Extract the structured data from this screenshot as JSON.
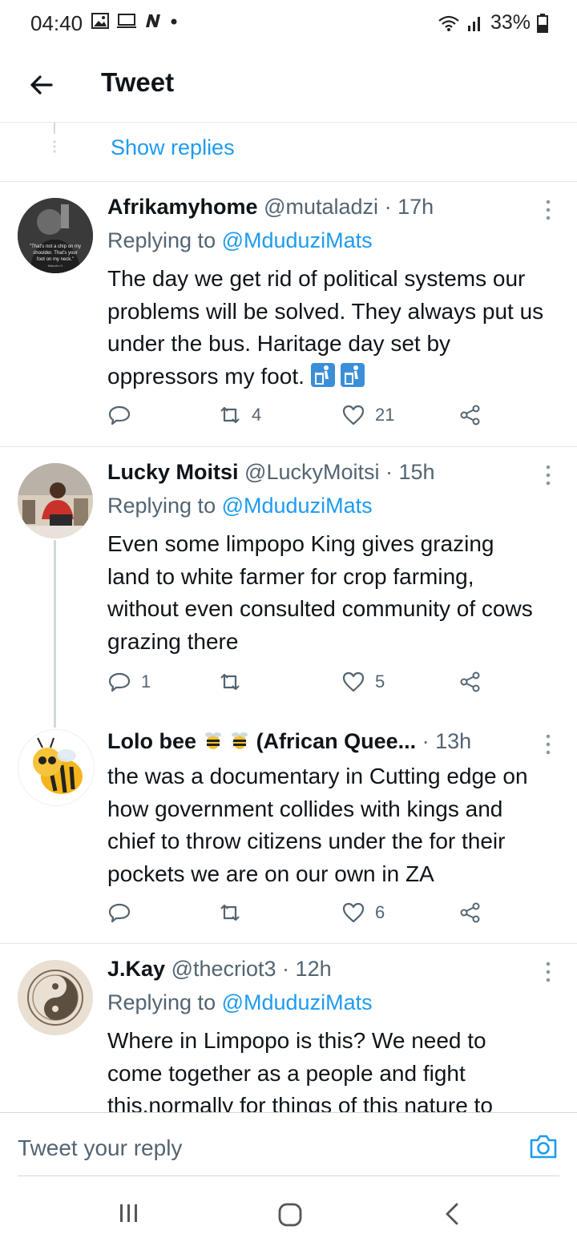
{
  "status_bar": {
    "time": "04:40",
    "battery": "33%",
    "icons": [
      "gallery-icon",
      "screen-icon",
      "n-icon",
      "dot-icon",
      "wifi-icon",
      "signal-icon",
      "battery-icon"
    ]
  },
  "header": {
    "back_icon": "arrow-left-icon",
    "title": "Tweet"
  },
  "thread": {
    "show_replies": "Show replies"
  },
  "tweets": [
    {
      "name": "Afrikamyhome",
      "handle": "@mutaladzi",
      "time": "17h",
      "replying_prefix": "Replying to",
      "replying_to": "@MduduziMats",
      "text": "The day we get rid of political systems our problems will be solved. They always put us under the bus. Haritage day set by oppressors my foot.",
      "emoji": [
        "litter-bin-icon",
        "litter-bin-icon"
      ],
      "avatar_quote": "\"That's not a chip on my shoulder. That's your foot on my neck.\"",
      "avatar_attrib": "Malcolm X",
      "replies": "",
      "retweets": "4",
      "likes": "21"
    },
    {
      "name": "Lucky Moitsi",
      "handle": "@LuckyMoitsi",
      "time": "15h",
      "replying_prefix": "Replying to",
      "replying_to": "@MduduziMats",
      "text": "Even some limpopo King gives grazing land to white farmer for crop farming, without even consulted community of cows grazing there",
      "replies": "1",
      "retweets": "",
      "likes": "5"
    },
    {
      "name": "Lolo bee",
      "name_suffix": "(African Quee...",
      "handle": "",
      "time": "13h",
      "text": "the was a documentary in Cutting edge on how government collides with kings and chief to throw citizens under the for their pockets we are on our own in ZA",
      "replies": "",
      "retweets": "",
      "likes": "6"
    },
    {
      "name": "J.Kay",
      "handle": "@thecriot3",
      "time": "12h",
      "replying_prefix": "Replying to",
      "replying_to": "@MduduziMats",
      "text_lines": [
        "Where in Limpopo is this? We need to",
        "come together as a people and fight",
        "this,normally for things of this nature to"
      ]
    }
  ],
  "reply_bar": {
    "placeholder": "Tweet your reply",
    "camera_icon": "camera-icon"
  },
  "nav_bar": {
    "icons": [
      "recent-apps-icon",
      "home-icon",
      "back-icon"
    ]
  },
  "colors": {
    "accent": "#1d9bf0",
    "text": "#0f1419",
    "muted": "#536471",
    "divider": "#e3e7ea"
  }
}
